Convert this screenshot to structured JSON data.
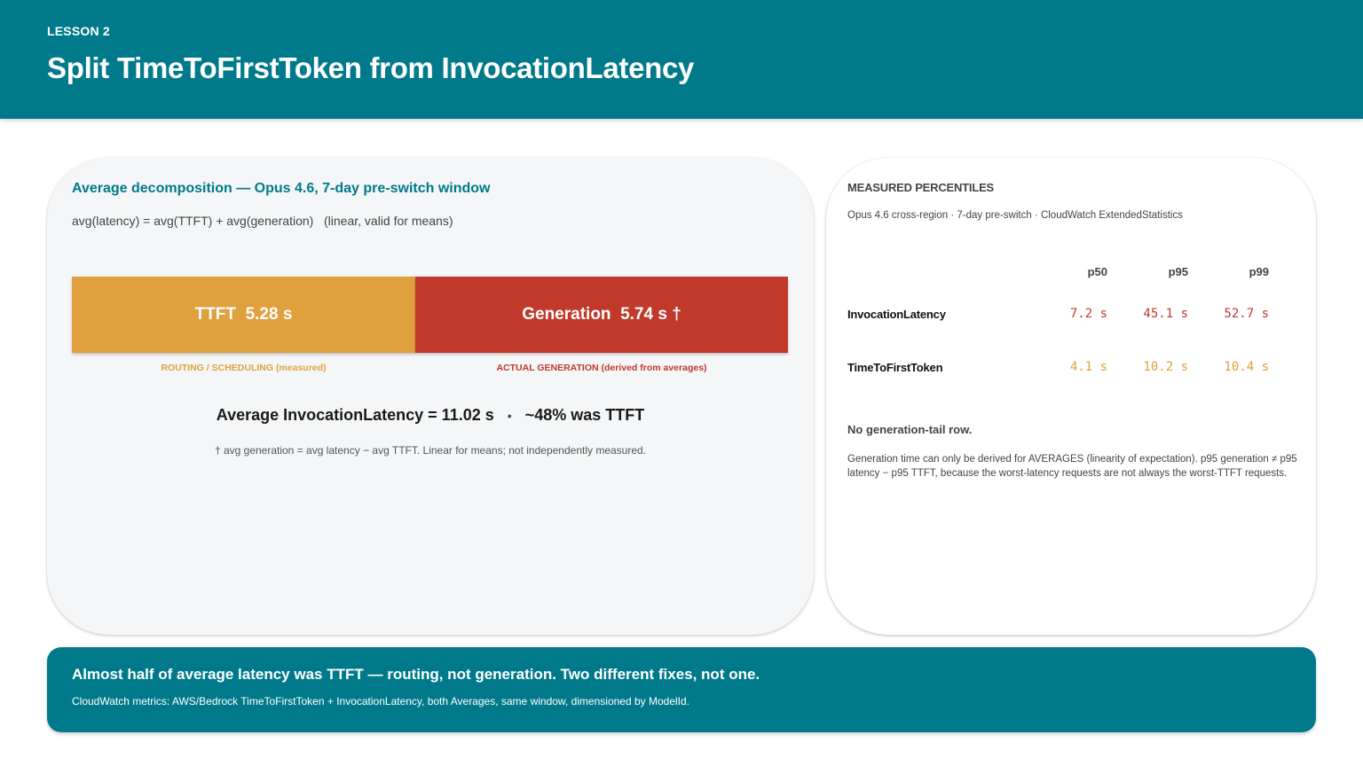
{
  "header": {
    "eyebrow": "LESSON 2",
    "title": "Split TimeToFirstToken from InvocationLatency"
  },
  "decomposition": {
    "heading": "Average decomposition — Opus 4.6, 7-day pre-switch window",
    "formula": "avg(latency) = avg(TTFT) + avg(generation)   (linear, valid for means)",
    "ttft_segment": {
      "label": "TTFT  5.28 s",
      "value_s": 5.28,
      "caption": "ROUTING / SCHEDULING  (measured)"
    },
    "generation_segment": {
      "label": "Generation  5.74 s †",
      "value_s": 5.74,
      "caption": "ACTUAL GENERATION  (derived from averages)"
    },
    "summary_total": "Average InvocationLatency = 11.02 s",
    "summary_separator": "•",
    "summary_share": "~48% was TTFT",
    "footnote": "† avg generation = avg latency − avg TTFT. Linear for means; not independently measured."
  },
  "percentiles": {
    "heading": "MEASURED PERCENTILES",
    "subheading": "Opus 4.6 cross-region · 7-day pre-switch · CloudWatch ExtendedStatistics",
    "columns": [
      "p50",
      "p95",
      "p99"
    ],
    "rows": [
      {
        "label": "InvocationLatency",
        "values": [
          "7.2 s",
          "45.1 s",
          "52.7 s"
        ]
      },
      {
        "label": "TimeToFirstToken",
        "values": [
          "4.1 s",
          "10.2 s",
          "10.4 s"
        ]
      }
    ],
    "note_title": "No generation-tail row.",
    "note_body": "Generation time can only be derived for AVERAGES (linearity of expectation). p95 generation ≠ p95 latency − p95 TTFT, because the worst-latency requests are not always the worst-TTFT requests."
  },
  "banner": {
    "title": "Almost half of average latency was TTFT — routing, not generation. Two different fixes, not one.",
    "subtitle": "CloudWatch metrics: AWS/Bedrock TimeToFirstToken + InvocationLatency, both Averages, same window, dimensioned by ModelId."
  },
  "colors": {
    "accent": "#007a8a",
    "ttft": "#e0a03e",
    "generation": "#c0392b"
  }
}
